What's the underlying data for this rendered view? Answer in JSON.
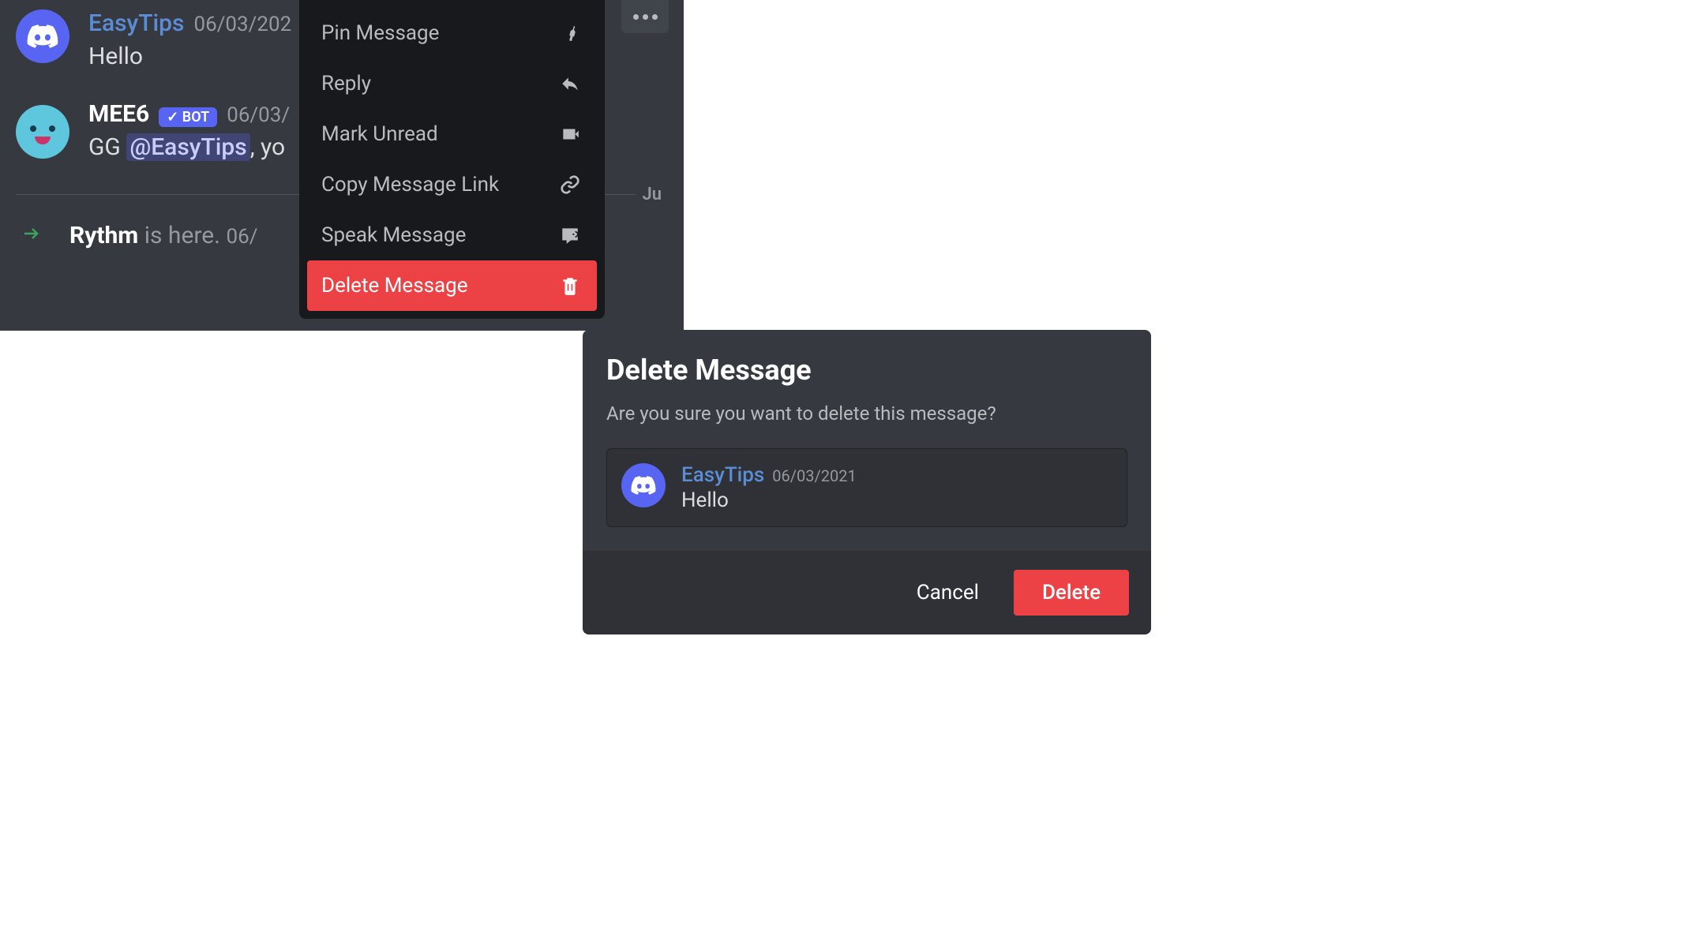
{
  "chat": {
    "messages": [
      {
        "username": "EasyTips",
        "timestamp": "06/03/202",
        "text": "Hello"
      },
      {
        "username": "MEE6",
        "bot_label": "✓ BOT",
        "timestamp": "06/03/",
        "text_prefix": "GG ",
        "mention": "@EasyTips",
        "text_suffix": ", yo"
      }
    ],
    "divider_text": "Ju",
    "system_message": {
      "name": "Rythm",
      "suffix": " is here. ",
      "timestamp": "06/"
    }
  },
  "context_menu": {
    "items": [
      {
        "label": "Pin Message",
        "icon": "pin"
      },
      {
        "label": "Reply",
        "icon": "reply"
      },
      {
        "label": "Mark Unread",
        "icon": "unread"
      },
      {
        "label": "Copy Message Link",
        "icon": "link"
      },
      {
        "label": "Speak Message",
        "icon": "speak"
      },
      {
        "label": "Delete Message",
        "icon": "trash",
        "danger": true
      }
    ]
  },
  "modal": {
    "title": "Delete Message",
    "subtitle": "Are you sure you want to delete this message?",
    "preview": {
      "username": "EasyTips",
      "timestamp": "06/03/2021",
      "text": "Hello"
    },
    "buttons": {
      "cancel": "Cancel",
      "delete": "Delete"
    }
  },
  "colors": {
    "blurple": "#5865f2",
    "danger": "#ed4245",
    "bg_primary": "#36393f",
    "bg_secondary": "#2f3136",
    "bg_floating": "#18191c"
  }
}
